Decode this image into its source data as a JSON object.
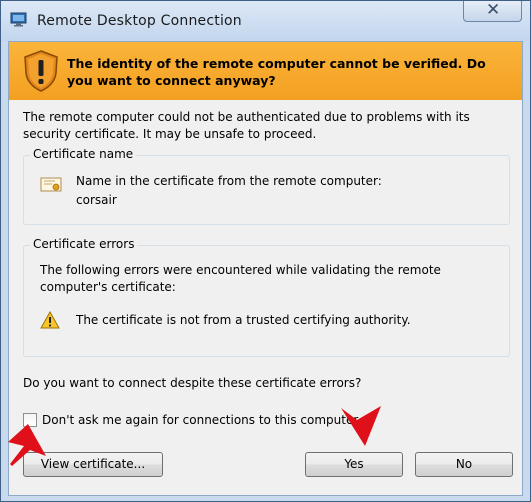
{
  "window": {
    "title": "Remote Desktop Connection",
    "close_label": "✕",
    "accent_color": "#f7a829"
  },
  "banner": {
    "message": "The identity of the remote computer cannot be verified. Do you want to connect anyway?",
    "icon": "warning-shield-icon"
  },
  "body": {
    "intro": "The remote computer could not be authenticated due to problems with its security certificate. It may be unsafe to proceed."
  },
  "certificate_name": {
    "group_label": "Certificate name",
    "line1": "Name in the certificate from the remote computer:",
    "line2": "corsair",
    "icon": "certificate-icon"
  },
  "certificate_errors": {
    "group_label": "Certificate errors",
    "intro": "The following errors were encountered while validating the remote computer's certificate:",
    "items": [
      {
        "text": "The certificate is not from a trusted certifying authority.",
        "icon": "warning-icon"
      }
    ]
  },
  "prompt": {
    "question": "Do you want to connect despite these certificate errors?",
    "checkbox_label": "Don't ask me again for connections to this computer",
    "checkbox_checked": false
  },
  "buttons": {
    "view_certificate": "View certificate...",
    "yes": "Yes",
    "no": "No"
  },
  "annotations": {
    "arrow_color": "#e0101a"
  }
}
